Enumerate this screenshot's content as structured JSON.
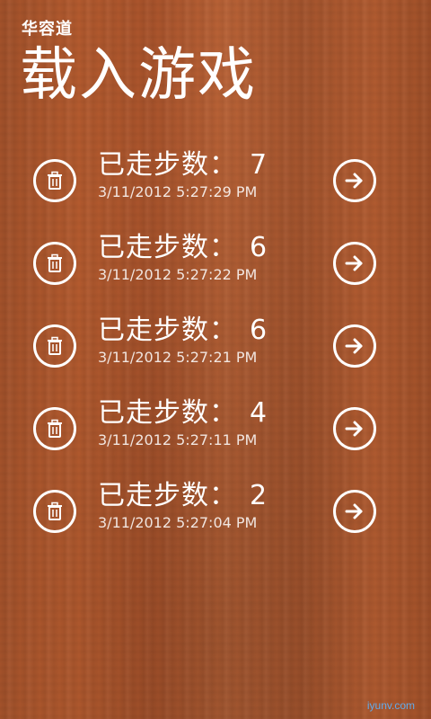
{
  "header": {
    "app_name": "华容道",
    "title": "载入游戏"
  },
  "saves": [
    {
      "steps_label": "已走步数：",
      "steps": "7",
      "time": "3/11/2012 5:27:29 PM"
    },
    {
      "steps_label": "已走步数：",
      "steps": "6",
      "time": "3/11/2012 5:27:22 PM"
    },
    {
      "steps_label": "已走步数：",
      "steps": "6",
      "time": "3/11/2012 5:27:21 PM"
    },
    {
      "steps_label": "已走步数：",
      "steps": "4",
      "time": "3/11/2012 5:27:11 PM"
    },
    {
      "steps_label": "已走步数：",
      "steps": "2",
      "time": "3/11/2012 5:27:04 PM"
    }
  ],
  "icons": {
    "delete": "trash-icon",
    "open": "arrow-right-icon"
  },
  "watermark": "iyunv.com",
  "colors": {
    "wood": "#a9532b",
    "text": "#ffffff"
  }
}
